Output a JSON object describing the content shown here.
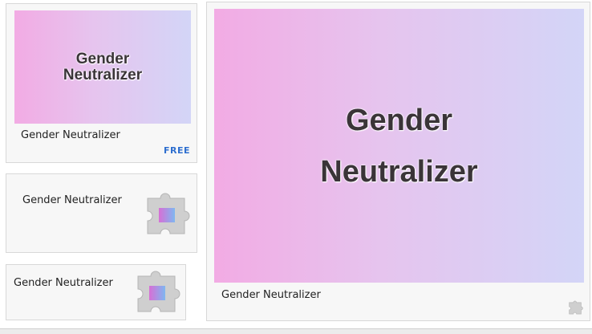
{
  "tile_large": {
    "hero_line1": "Gender",
    "hero_line2": "Neutralizer",
    "name": "Gender Neutralizer",
    "price": "FREE"
  },
  "tile_medium": {
    "name": "Gender Neutralizer",
    "icon": "puzzle-piece-icon"
  },
  "tile_small": {
    "name": "Gender Neutralizer",
    "icon": "puzzle-piece-icon"
  },
  "tile_marquee": {
    "hero_line1": "Gender",
    "hero_line2": "Neutralizer",
    "name": "Gender Neutralizer",
    "icon": "puzzle-piece-icon"
  },
  "colors": {
    "gradient_start": "#f2abe4",
    "gradient_mid": "#e6c4ee",
    "gradient_end": "#d3d5f7",
    "price_text": "#2f6fcf",
    "hero_text": "#3a3438"
  }
}
